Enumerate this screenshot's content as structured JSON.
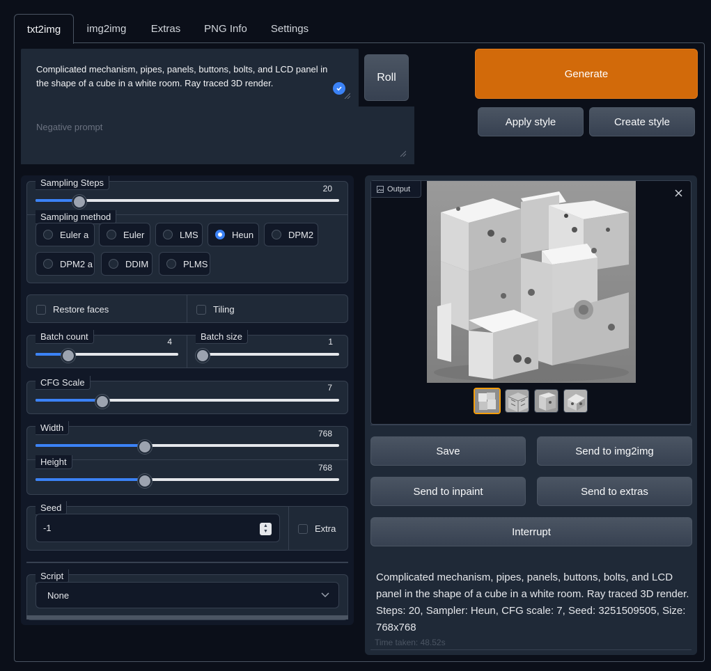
{
  "tabs": [
    "txt2img",
    "img2img",
    "Extras",
    "PNG Info",
    "Settings"
  ],
  "prompt": {
    "text": "Complicated mechanism, pipes, panels, buttons, bolts, and LCD panel in the shape of a cube in a white room. Ray traced 3D render.",
    "negative_placeholder": "Negative prompt"
  },
  "buttons": {
    "roll": "Roll",
    "generate": "Generate",
    "apply_style": "Apply style",
    "create_style": "Create style",
    "save": "Save",
    "send_img2img": "Send to img2img",
    "send_inpaint": "Send to inpaint",
    "send_extras": "Send to extras",
    "interrupt": "Interrupt"
  },
  "sampling_steps": {
    "label": "Sampling Steps",
    "value": "20",
    "fraction": 0.145
  },
  "sampling_method": {
    "label": "Sampling method",
    "options": [
      "Euler a",
      "Euler",
      "LMS",
      "Heun",
      "DPM2",
      "DPM2 a",
      "DDIM",
      "PLMS"
    ],
    "selected": "Heun"
  },
  "restore_faces": "Restore faces",
  "tiling": "Tiling",
  "batch_count": {
    "label": "Batch count",
    "value": "4",
    "fraction": 0.23
  },
  "batch_size": {
    "label": "Batch size",
    "value": "1",
    "fraction": 0.0
  },
  "cfg_scale": {
    "label": "CFG Scale",
    "value": "7",
    "fraction": 0.22
  },
  "width": {
    "label": "Width",
    "value": "768",
    "fraction": 0.36
  },
  "height": {
    "label": "Height",
    "value": "768",
    "fraction": 0.36
  },
  "seed": {
    "label": "Seed",
    "value": "-1",
    "extra": "Extra"
  },
  "script": {
    "label": "Script",
    "value": "None"
  },
  "output": {
    "label": "Output",
    "info": "Complicated mechanism, pipes, panels, buttons, bolts, and LCD panel in the shape of a cube in a white room. Ray traced 3D render. Steps: 20, Sampler: Heun, CFG scale: 7, Seed: 3251509505, Size: 768x768",
    "time": "Time taken: 48.52s"
  },
  "colors": {
    "accent": "#3b82f6",
    "generate": "#d26a0a",
    "bg": "#0b0f19",
    "panel": "#1f2937"
  },
  "icons": [
    "check-circle-icon",
    "image-icon",
    "close-icon",
    "chevron-down-icon",
    "spinner-arrows-icon"
  ]
}
